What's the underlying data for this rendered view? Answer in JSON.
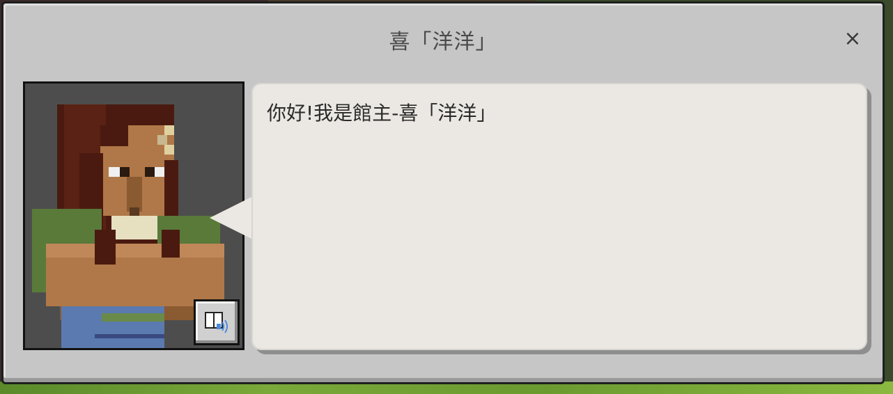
{
  "dialog": {
    "title": "喜「洋洋」",
    "close_label": "×",
    "message": "你好!我是館主-喜「洋洋」"
  },
  "icons": {
    "close": "close-icon",
    "speak": "book-speaker-icon"
  },
  "colors": {
    "dialog_bg": "#c6c6c6",
    "bubble_bg": "#ebe8e3",
    "portrait_bg": "#4d4d4d",
    "title_text": "#4a4a4a"
  }
}
